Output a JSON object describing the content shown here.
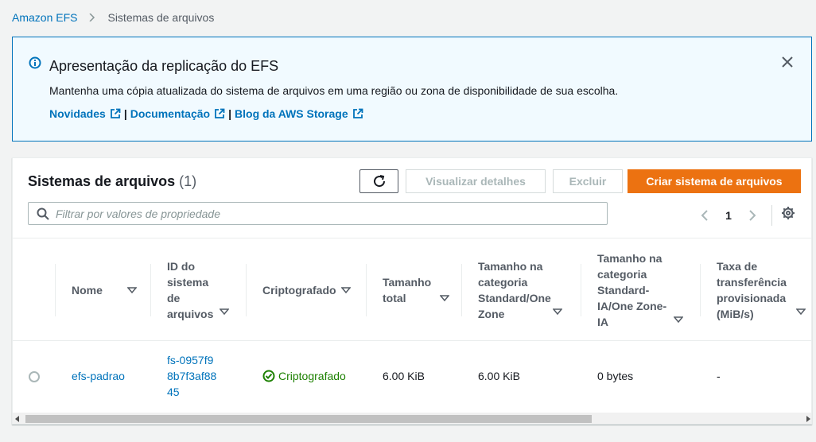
{
  "breadcrumb": {
    "root": "Amazon EFS",
    "current": "Sistemas de arquivos"
  },
  "flash": {
    "title": "Apresentação da replicação do EFS",
    "description": "Mantenha uma cópia atualizada do sistema de arquivos em uma região ou zona de disponibilidade de sua escolha.",
    "links": [
      "Novidades",
      "Documentação",
      "Blog da AWS Storage"
    ],
    "separator": "|"
  },
  "panel": {
    "title": "Sistemas de arquivos",
    "count": "(1)",
    "buttons": {
      "details": "Visualizar detalhes",
      "delete": "Excluir",
      "create": "Criar sistema de arquivos"
    },
    "filter_placeholder": "Filtrar por valores de propriedade",
    "page": "1"
  },
  "table": {
    "columns": [
      "Nome",
      "ID do sistema de arquivos",
      "Criptografado",
      "Tamanho total",
      "Tamanho na categoria Standard/One Zone",
      "Tamanho na categoria Standard-IA/One Zone-IA",
      "Taxa de transferência provisionada (MiB/s)"
    ],
    "rows": [
      {
        "name": "efs-padrao",
        "id": "fs-0957f98b7f3af8845",
        "encrypted": "Criptografado",
        "total_size": "6.00 KiB",
        "standard_size": "6.00 KiB",
        "ia_size": "0 bytes",
        "throughput": "-"
      }
    ]
  },
  "colors": {
    "link": "#0073bb",
    "primary": "#ec7211",
    "success": "#1d8102",
    "info_bg": "#f1faff"
  }
}
